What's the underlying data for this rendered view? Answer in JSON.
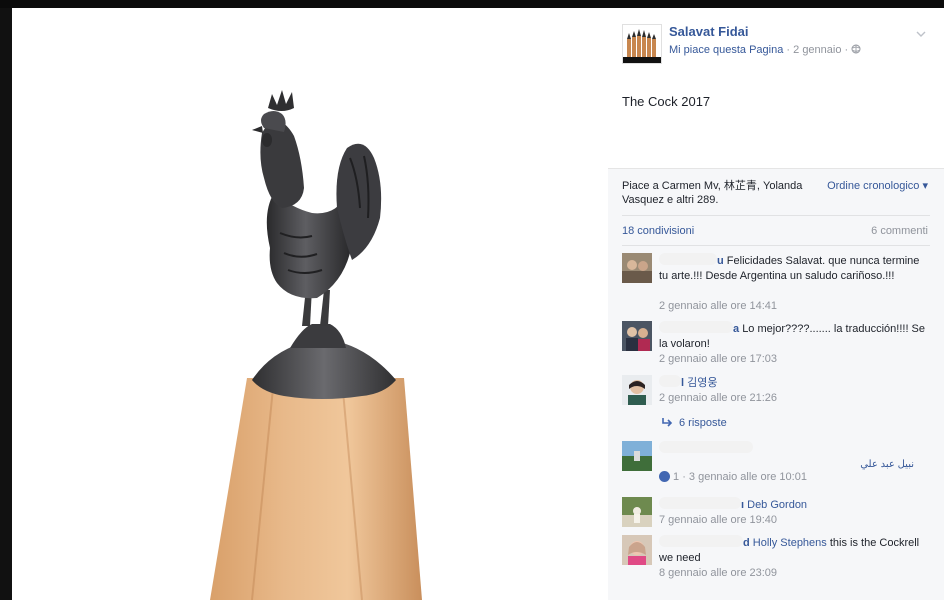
{
  "post": {
    "page_name": "Salavat Fidai",
    "like_page_label": "Mi piace questa Pagina",
    "meta_separator_1": " · ",
    "date": "2 gennaio",
    "meta_separator_2": " · ",
    "text": "The Cock 2017"
  },
  "reactions": {
    "likes_text": "Piace a Carmen Mv, 林芷青, Yolanda Vasquez e altri 289.",
    "order_label": "Ordine cronologico ▾",
    "shares": "18 condivisioni",
    "comments_count": "6 commenti"
  },
  "comments": [
    {
      "author_tail": "u",
      "text": "Felicidades Salavat. que nunca termine tu arte.!!! Desde Argentina un saludo cariñoso.!!!",
      "time": "2 gennaio alle ore 14:41"
    },
    {
      "author_tail": "a",
      "text": "Lo mejor????....... la traducción!!!! Se la volaron!",
      "time": "2 gennaio alle ore 17:03"
    },
    {
      "author_tail": "l",
      "tag": "김영웅",
      "time": "2 gennaio alle ore 21:26",
      "replies": "6 risposte"
    },
    {
      "text": "نبيل عبد علي",
      "like_count": "1",
      "time": "· 3 gennaio alle ore 10:01"
    },
    {
      "author_tail": "ı",
      "tag": "Deb Gordon",
      "time": "7 gennaio alle ore 19:40"
    },
    {
      "author_tail": "d",
      "tag": "Holly Stephens",
      "text": "this is the Cockrell we need",
      "time": "8 gennaio alle ore 23:09"
    }
  ],
  "icons": {
    "globe": "globe-icon",
    "chevron": "chevron-down-icon",
    "reply": "reply-arrow-icon",
    "like": "like-thumb-icon"
  },
  "colors": {
    "link": "#365899",
    "meta": "#90949c",
    "footer_bg": "#f6f7f9"
  }
}
